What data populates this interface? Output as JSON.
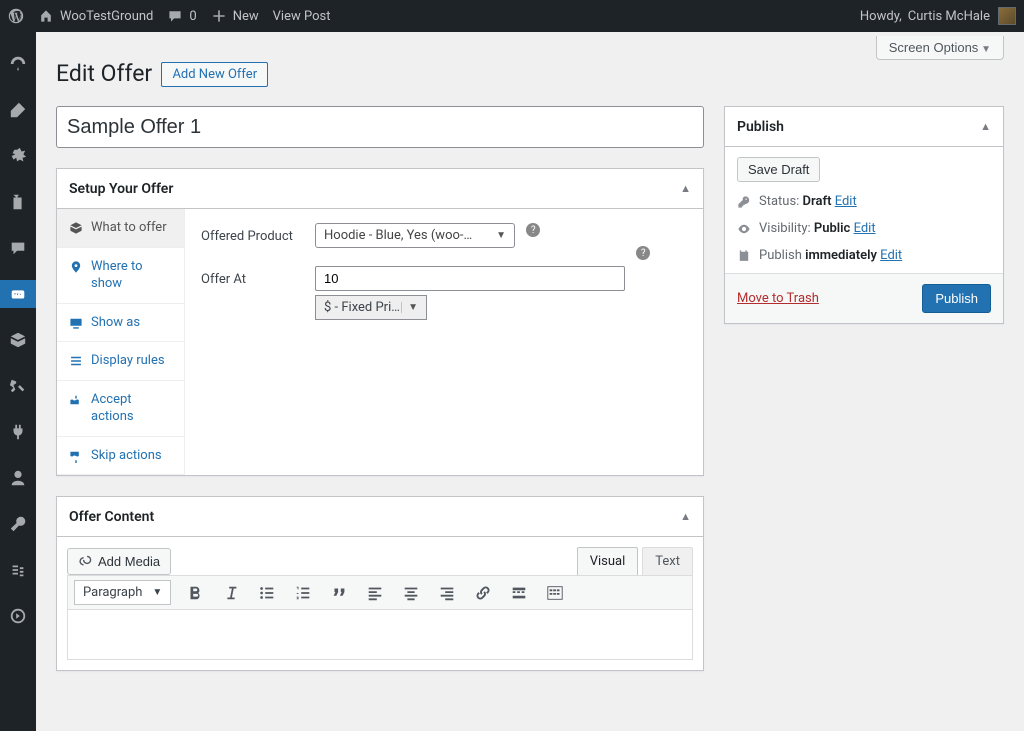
{
  "adminbar": {
    "site_name": "WooTestGround",
    "comments_count": "0",
    "new_label": "New",
    "view_post": "View Post",
    "howdy_prefix": "Howdy, ",
    "user_name": "Curtis McHale"
  },
  "screen_options_label": "Screen Options",
  "page_title": "Edit Offer",
  "add_new_label": "Add New Offer",
  "post_title": "Sample Offer 1",
  "setup_box": {
    "title": "Setup Your Offer",
    "tabs": {
      "what": "What to offer",
      "where": "Where to show",
      "showas": "Show as",
      "rules": "Display rules",
      "accept": "Accept actions",
      "skip": "Skip actions"
    },
    "offered_product_label": "Offered Product",
    "offered_product_value": "Hoodie - Blue, Yes (woo-…",
    "offer_at_label": "Offer At",
    "offer_at_value": "10",
    "offer_at_mode": "$ - Fixed Price"
  },
  "publish": {
    "title": "Publish",
    "save_draft": "Save Draft",
    "status_label": "Status: ",
    "status_value": "Draft",
    "edit": "Edit",
    "visibility_label": "Visibility: ",
    "visibility_value": "Public",
    "publish_time_label": "Publish ",
    "publish_time_value": "immediately",
    "trash": "Move to Trash",
    "publish_btn": "Publish"
  },
  "content_box": {
    "title": "Offer Content",
    "add_media": "Add Media",
    "tab_visual": "Visual",
    "tab_text": "Text",
    "paragraph_label": "Paragraph"
  }
}
